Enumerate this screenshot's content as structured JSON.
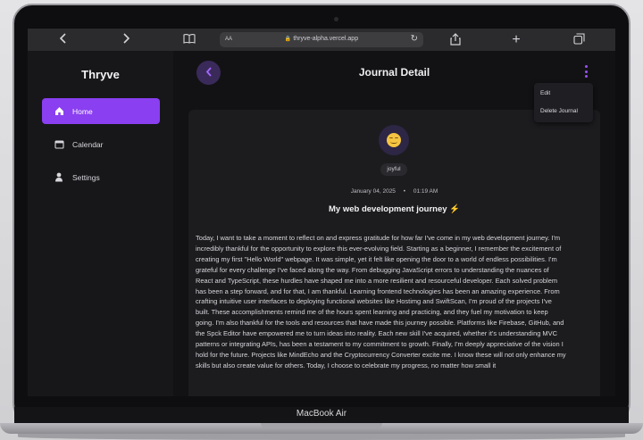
{
  "device": {
    "label": "MacBook Air"
  },
  "browser": {
    "url": "thryve-alpha.vercel.app",
    "aa_label": "AA"
  },
  "sidebar": {
    "brand": "Thryve",
    "items": [
      {
        "label": "Home",
        "icon": "home-icon",
        "active": true
      },
      {
        "label": "Calendar",
        "icon": "calendar-icon",
        "active": false
      },
      {
        "label": "Settings",
        "icon": "person-icon",
        "active": false
      }
    ]
  },
  "header": {
    "title": "Journal Detail"
  },
  "menu": {
    "edit": "Edit",
    "delete": "Delete Journal"
  },
  "entry": {
    "mood": "joyful",
    "date": "January 04, 2025",
    "time": "01:19 AM",
    "title": "My web development journey ⚡",
    "body": "Today, I want to take a moment to reflect on and express gratitude for how far I've come in my web development journey. I'm incredibly thankful for the opportunity to explore this ever-evolving field. Starting as a beginner, I remember the excitement of creating my first \"Hello World\" webpage. It was simple, yet it felt like opening the door to a world of endless possibilities. I'm grateful for every challenge I've faced along the way. From debugging JavaScript errors to understanding the nuances of React and TypeScript, these hurdles have shaped me into a more resilient and resourceful developer. Each solved problem has been a step forward, and for that, I am thankful. Learning frontend technologies has been an amazing experience. From crafting intuitive user interfaces to deploying functional websites like Hostimg and SwiftScan, I'm proud of the projects I've built. These accomplishments remind me of the hours spent learning and practicing, and they fuel my motivation to keep going. I'm also thankful for the tools and resources that have made this journey possible. Platforms like Firebase, GitHub, and the Spck Editor have empowered me to turn ideas into reality. Each new skill I've acquired, whether it's understanding MVC patterns or integrating APIs, has been a testament to my commitment to growth. Finally, I'm deeply appreciative of the vision I hold for the future. Projects like MindEcho and the Cryptocurrency Converter excite me. I know these will not only enhance my skills but also create value for others. Today, I choose to celebrate my progress, no matter how small it"
  },
  "colors": {
    "accent": "#8a3ff0",
    "background": "#121214",
    "card": "#1c1c1f"
  }
}
